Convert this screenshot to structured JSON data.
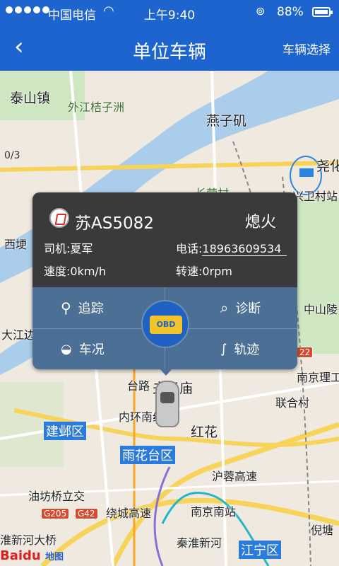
{
  "status_bar": {
    "carrier": "中国电信",
    "time": "上午9:40",
    "battery": "88%"
  },
  "nav": {
    "back_icon": "chevron-left-icon",
    "title": "单位车辆",
    "right_label": "车辆选择"
  },
  "map": {
    "scale_text": "0/3",
    "labels": {
      "l1": "泰山镇",
      "l2": "外江桔子洲",
      "l3": "燕子矶",
      "l4": "尧化",
      "l5": "长营村",
      "l6": "兴卫村站",
      "l7": "西埂",
      "l8": "中山陵",
      "l9": "大江边",
      "l10": "南京理工",
      "l11": "联合村",
      "l12": "内环南线",
      "l13": "建邺区",
      "l14": "红花",
      "l15": "雨花台区",
      "l16": "沪蓉高速",
      "l17": "油坊桥立交",
      "l18": "绕城高速",
      "l19": "南京南站",
      "l20": "淮新河大桥",
      "l21": "秦淮新河",
      "l22": "江宁区",
      "l23": "倪塘",
      "l24": "台路",
      "l25": "夫子庙"
    },
    "shields": {
      "s1": "G205",
      "s2": "G42",
      "s3": "22"
    },
    "baidu_logo": "Baidu",
    "baidu_map": "地图"
  },
  "popup": {
    "plate": "苏AS5082",
    "status": "熄火",
    "driver": "司机:夏军",
    "phone_label": "电话:",
    "phone": "18963609534",
    "speed": "速度:0km/h",
    "rpm": "转速:0rpm",
    "actions": {
      "track": "追踪",
      "diagnose": "诊断",
      "condition": "车况",
      "trajectory": "轨迹"
    },
    "obd_label": "OBD"
  },
  "colors": {
    "primary": "#1e64cf",
    "popup_top": "#3a3a3c",
    "popup_bottom": "#4b6f95"
  }
}
